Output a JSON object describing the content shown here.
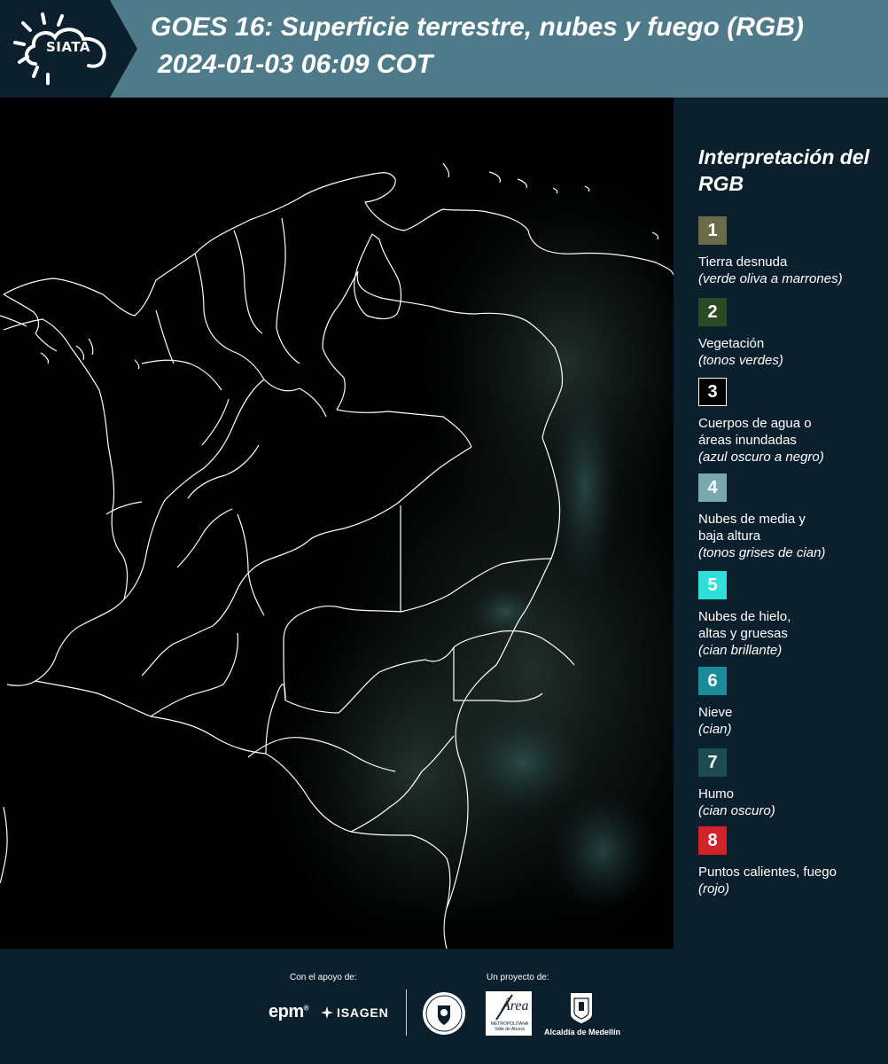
{
  "header": {
    "logo_text": "SIATA",
    "title": "GOES 16: Superficie terrestre, nubes y fuego (RGB)",
    "datetime": "2024-01-03 06:09 COT",
    "background_color": "#4e7a89",
    "logo_panel_color": "#0c1f2c"
  },
  "map": {
    "description_icon": "satellite-rgb-map",
    "background_color": "#000000",
    "border_color": "#ffffff"
  },
  "legend": {
    "title": "Interpretación del RGB",
    "items": [
      {
        "number": "1",
        "label": "Tierra desnuda",
        "sub": "(verde oliva a marrones)",
        "color": "#6b6b4a"
      },
      {
        "number": "2",
        "label": "Vegetación",
        "sub": "(tonos verdes)",
        "color": "#2b4a25"
      },
      {
        "number": "3",
        "label": "Cuerpos de agua o áreas inundadas",
        "sub": "(azul oscuro a negro)",
        "color": "#000000"
      },
      {
        "number": "4",
        "label": "Nubes de media y baja altura",
        "sub": "(tonos grises de cian)",
        "color": "#7aa9ab"
      },
      {
        "number": "5",
        "label": "Nubes de hielo, altas y gruesas",
        "sub": "(cian brillante)",
        "color": "#2ee0d8"
      },
      {
        "number": "6",
        "label": "Nieve",
        "sub": "(cian)",
        "color": "#1b8a99"
      },
      {
        "number": "7",
        "label": "Humo",
        "sub": "(cian oscuro)",
        "color": "#1d4c4f"
      },
      {
        "number": "8",
        "label": "Puntos calientes, fuego",
        "sub": "(rojo)",
        "color": "#d0232a"
      }
    ]
  },
  "footer": {
    "support_label": "Con el apoyo de:",
    "project_label": "Un proyecto de:",
    "epm": "epm",
    "isagen": "ISAGEN",
    "area_word": "Área",
    "area_sub": "METROPOLITANA Valle de Aburrá",
    "alcaldia": "Alcaldía de Medellín"
  }
}
